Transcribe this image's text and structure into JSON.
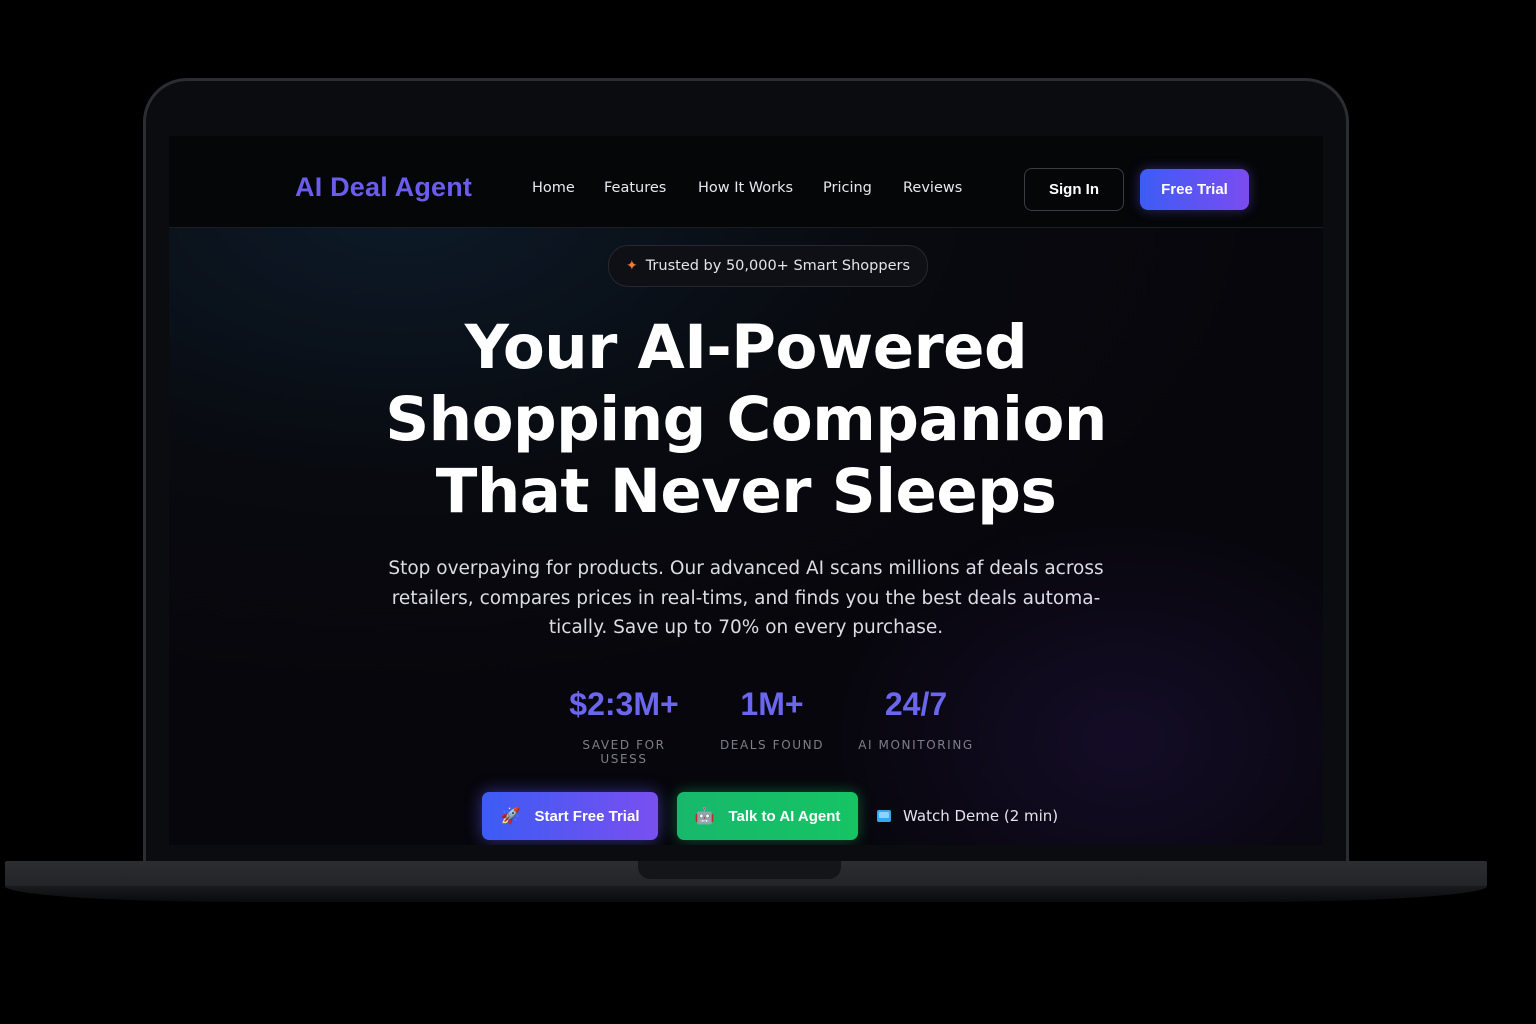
{
  "navbar": {
    "logo": "AI Deal Agent",
    "links": [
      "Home",
      "Features",
      "How It Works",
      "Pricing",
      "Reviews"
    ],
    "sign_in": "Sign In",
    "free_trial": "Free Trial"
  },
  "hero": {
    "badge_icon": "sparkle-icon",
    "badge_text": "Trusted by 50,000+ Smart Shoppers",
    "headline": [
      "Your AI-Powered",
      "Shopping Companion",
      "That Never Sleeps"
    ],
    "subtext": "Stop overpaying for products. Our advanced AI scans millions af deals across retailers, compares prices in real-tims, and finds you the best deals automa-tically. Save up to 70% on every purchase.",
    "stats": [
      {
        "value": "$2:3M+",
        "label": "SAVED FOR USESS"
      },
      {
        "value": "1M+",
        "label": "DEALS FOUND"
      },
      {
        "value": "24/7",
        "label": "AI MONITORING"
      }
    ],
    "cta_start": {
      "icon": "rocket-icon",
      "label": "Start Free Trial"
    },
    "cta_talk": {
      "icon": "robot-icon",
      "label": "Talk to AI Agent"
    },
    "watch_demo": {
      "icon": "tv-icon",
      "label": "Watch Deme (2 min)"
    }
  },
  "colors": {
    "accent": "#6b5cf0",
    "stat_value": "#6b66ee",
    "cta_blue_start": "#3c5cf4",
    "cta_purple_end": "#7a4ff0",
    "cta_green": "#17b86b",
    "background": "#000000"
  }
}
